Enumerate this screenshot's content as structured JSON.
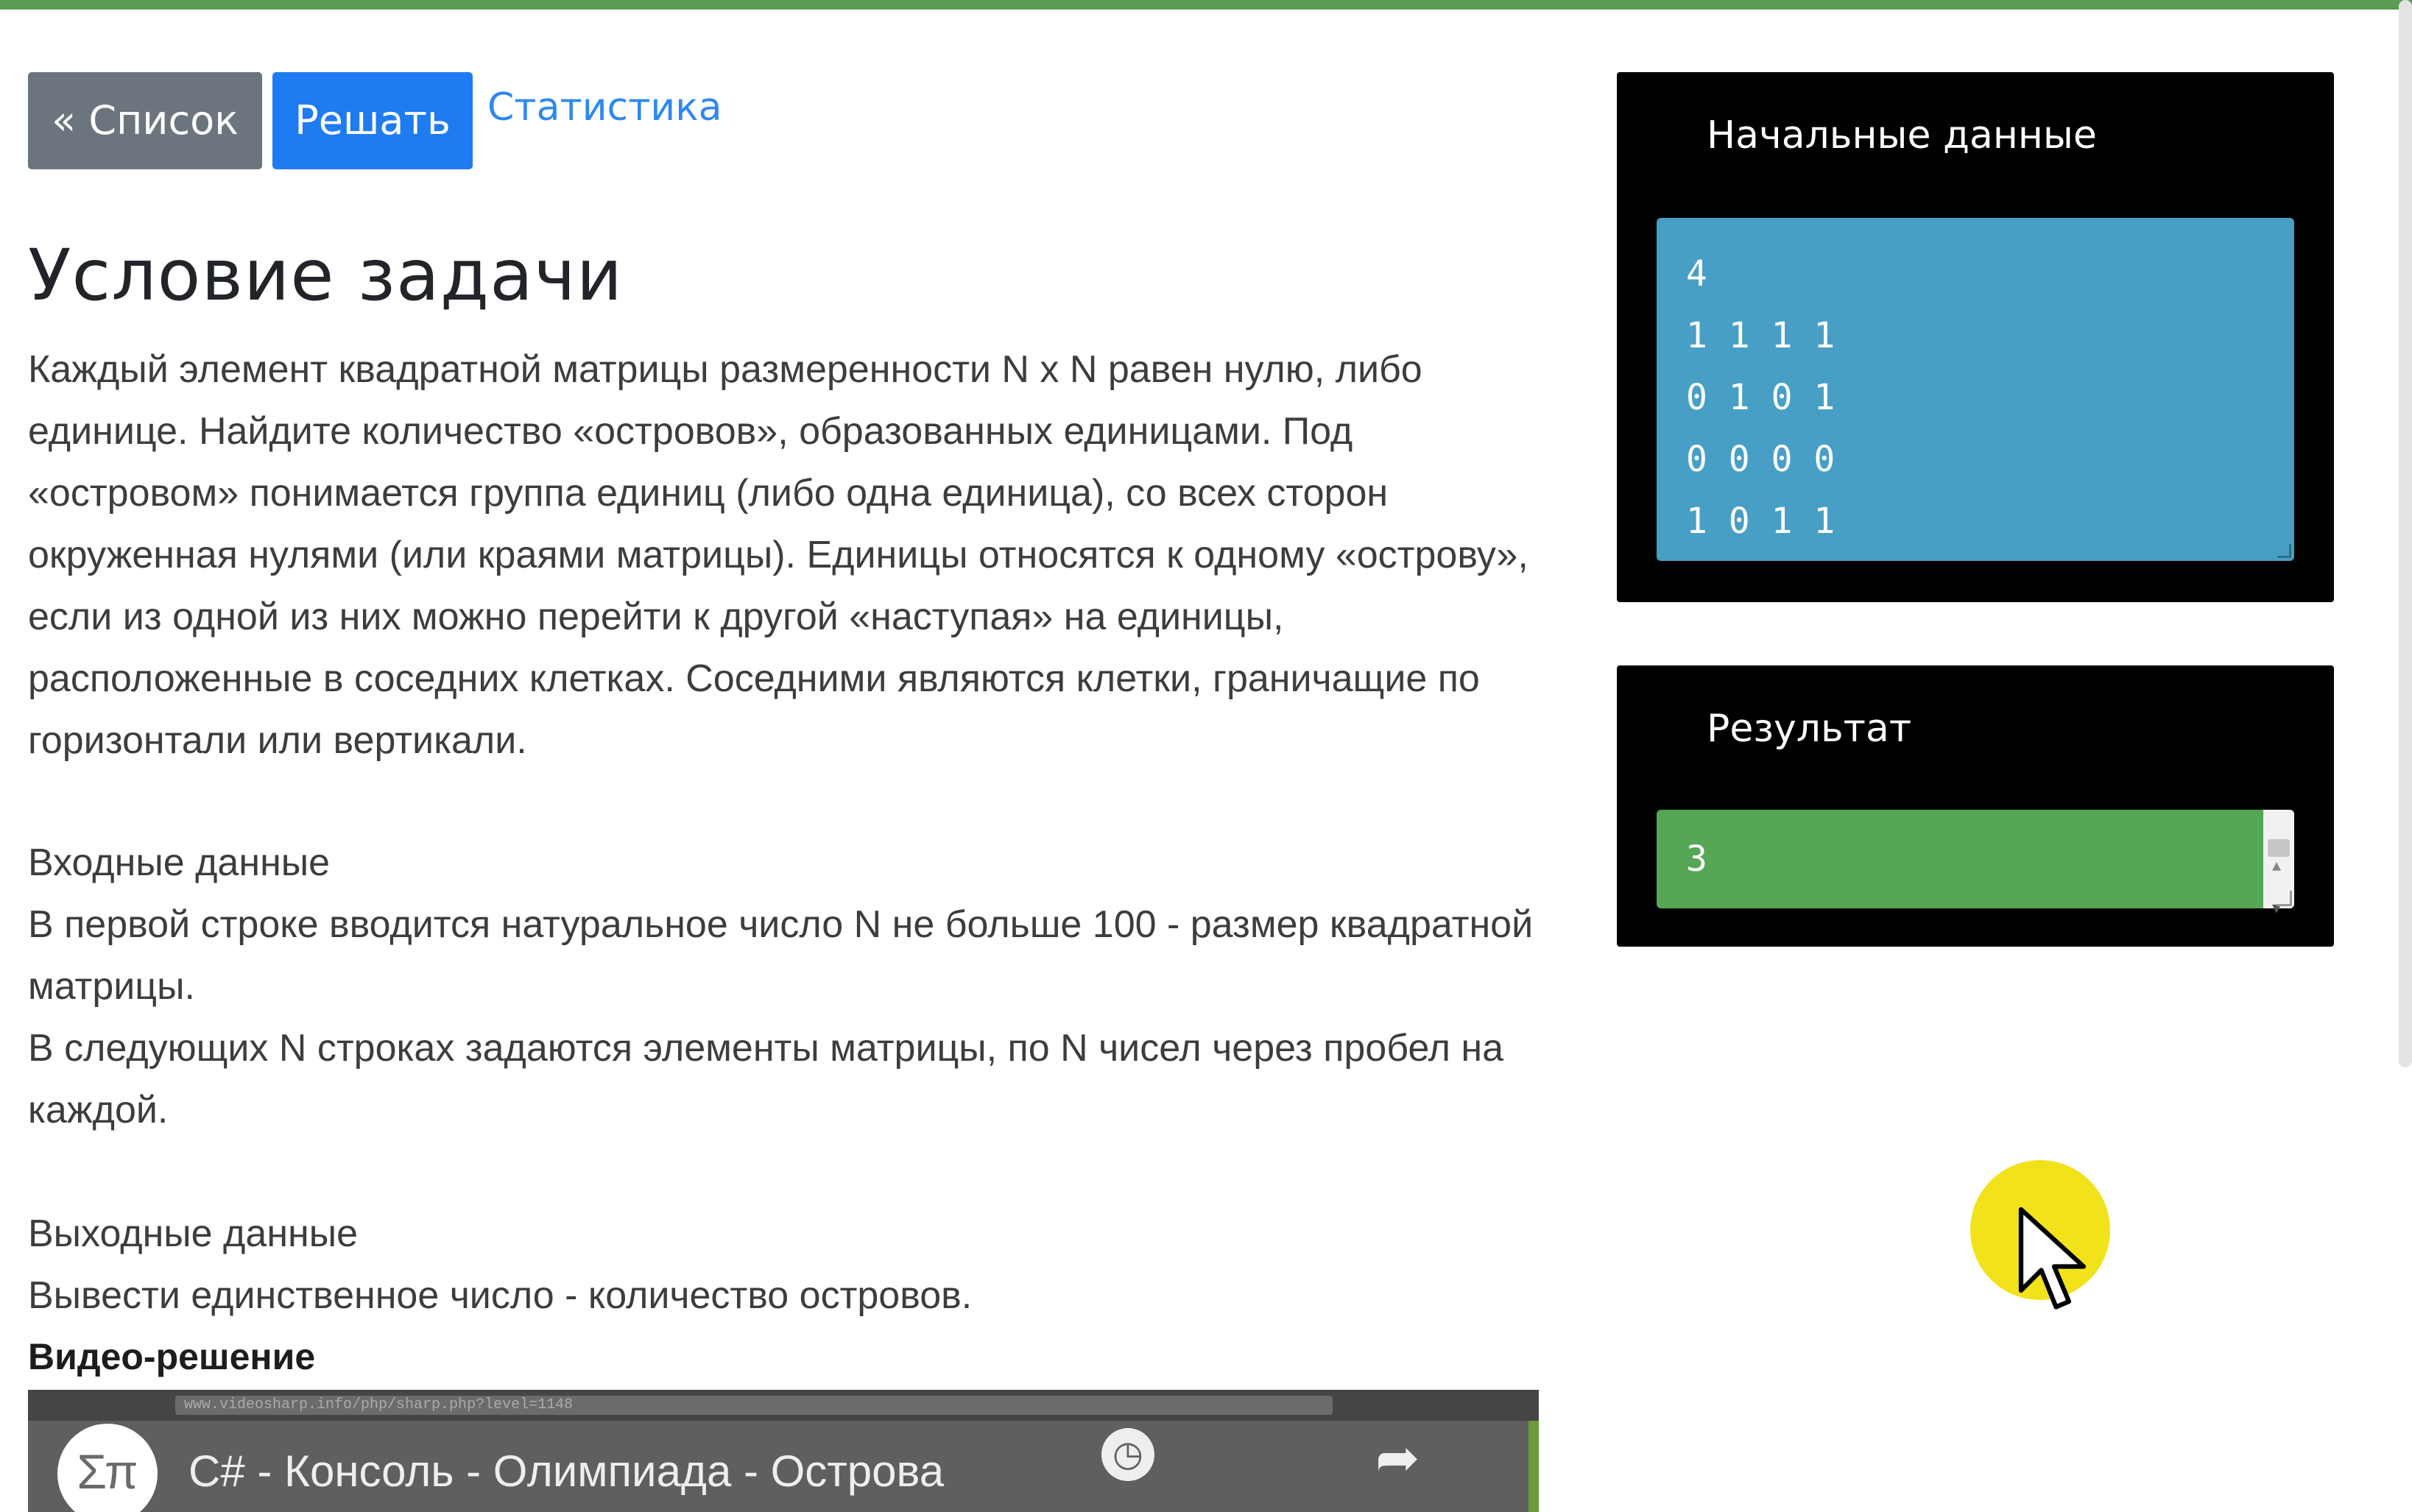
{
  "nav": {
    "list_button": "« Список",
    "solve_button": "Решать",
    "stats_link": "Статистика"
  },
  "problem": {
    "title": "Условие задачи",
    "description": "Каждый элемент квадратной матрицы размеренности N x N равен нулю, либо единице. Найдите количество «островов», образованных единицами. Под «островом» понимается группа единиц (либо одна единица), со всех сторон окруженная нулями (или краями матрицы). Единицы относятся к одному «острову», если из одной из них можно перейти к другой «наступая» на единицы, расположенные в соседних клетках. Соседними являются клетки, граничащие по горизонтали или вертикали.",
    "input_heading": "Входные данные",
    "input_line1": "В первой строке вводится натуральное число N не больше 100 - размер квадратной матрицы.",
    "input_line2": "В следующих N строках задаются элементы матрицы, по N чисел через пробел на каждой.",
    "output_heading": "Выходные данные",
    "output_line1": "Вывести единственное число - количество островов.",
    "video_heading": "Видео-решение"
  },
  "video": {
    "title": "C# - Консоль - Олимпиада - Острова",
    "address_bar": "www.videosharp.info/php/sharp.php?level=1148",
    "logo_icon": "sigma-pi-logo",
    "watch_later_icon": "clock-icon",
    "share_icon": "share-arrow-icon"
  },
  "input_panel": {
    "label": "Начальные данные",
    "value": "4\n1 1 1 1\n0 1 0 1\n0 0 0 0\n1 0 1 1",
    "background_color": "#489fc5"
  },
  "result_panel": {
    "label": "Результат",
    "value": "3",
    "background_color": "#55a655"
  },
  "colors": {
    "top_bar": "#5a9c54",
    "list_button": "#6c757d",
    "solve_button": "#1f7bf1",
    "link": "#2f88f0",
    "panel": "#000000",
    "cursor_highlight": "#f2e21a"
  }
}
